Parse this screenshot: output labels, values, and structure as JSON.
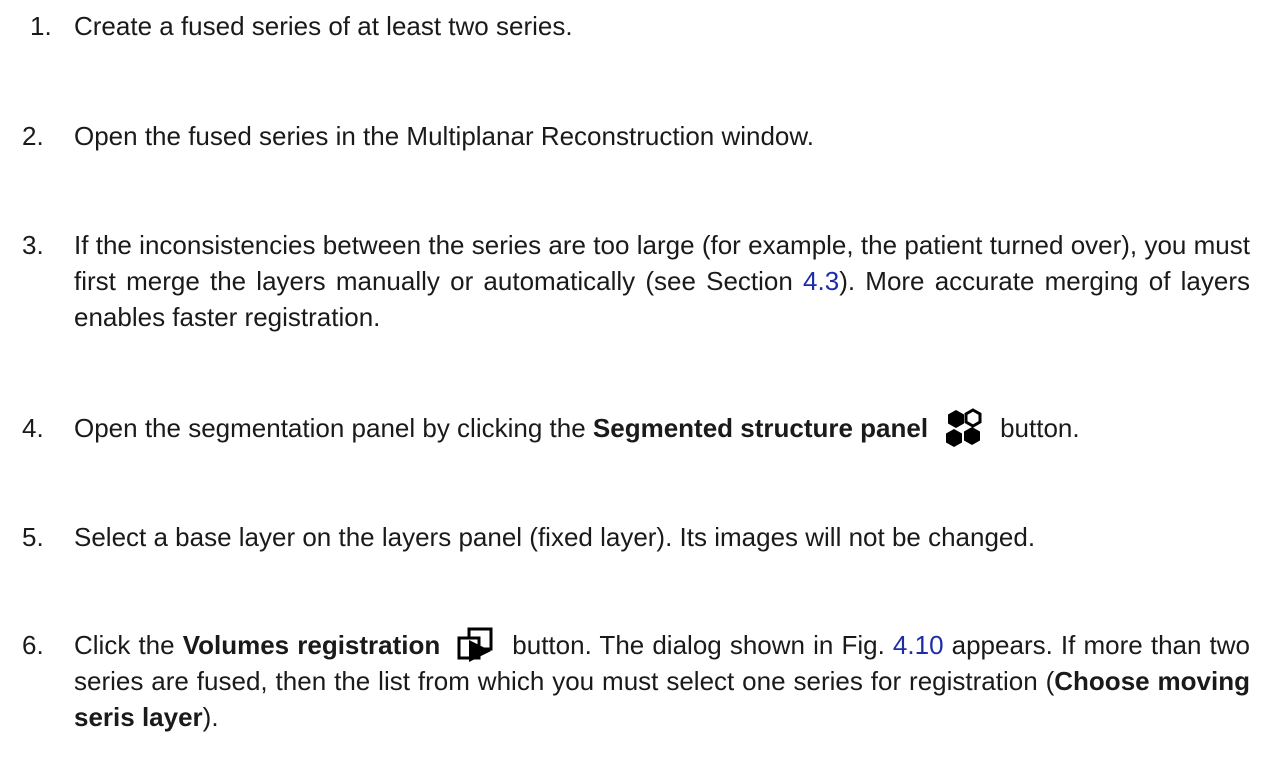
{
  "steps": [
    {
      "number": "1.",
      "text": "Create a fused series of at least two series."
    },
    {
      "number": "2.",
      "text": "Open the fused series in the Multiplanar Reconstruction window."
    },
    {
      "number": "3.",
      "text_before": "If the inconsistencies between the series are too large (for example, the patient turned over), you must first merge the layers manually or automatically (see Section ",
      "section_ref": "4.3",
      "text_after": "). More accurate merging of layers enables faster registration."
    },
    {
      "number": "4.",
      "text_before": "Open the segmentation panel by clicking the ",
      "bold": "Segmented structure panel",
      "icon": "segmented-structure-icon",
      "text_after": "button."
    },
    {
      "number": "5.",
      "text": "Select a base layer on the layers panel (fixed layer). Its images will not be changed."
    },
    {
      "number": "6.",
      "text_before": "Click the ",
      "bold": "Volumes registration",
      "icon": "volumes-registration-icon",
      "text_mid": "button. The dialog shown in Fig. ",
      "figure_ref": "4.10",
      "text_after": " appears. If more than two series are fused, then the list from which you must select one series for registration (",
      "bold_2": "Choose moving seris layer",
      "text_end": ")."
    }
  ],
  "colors": {
    "text": "#1a1a1a",
    "link": "#1c2da8"
  }
}
